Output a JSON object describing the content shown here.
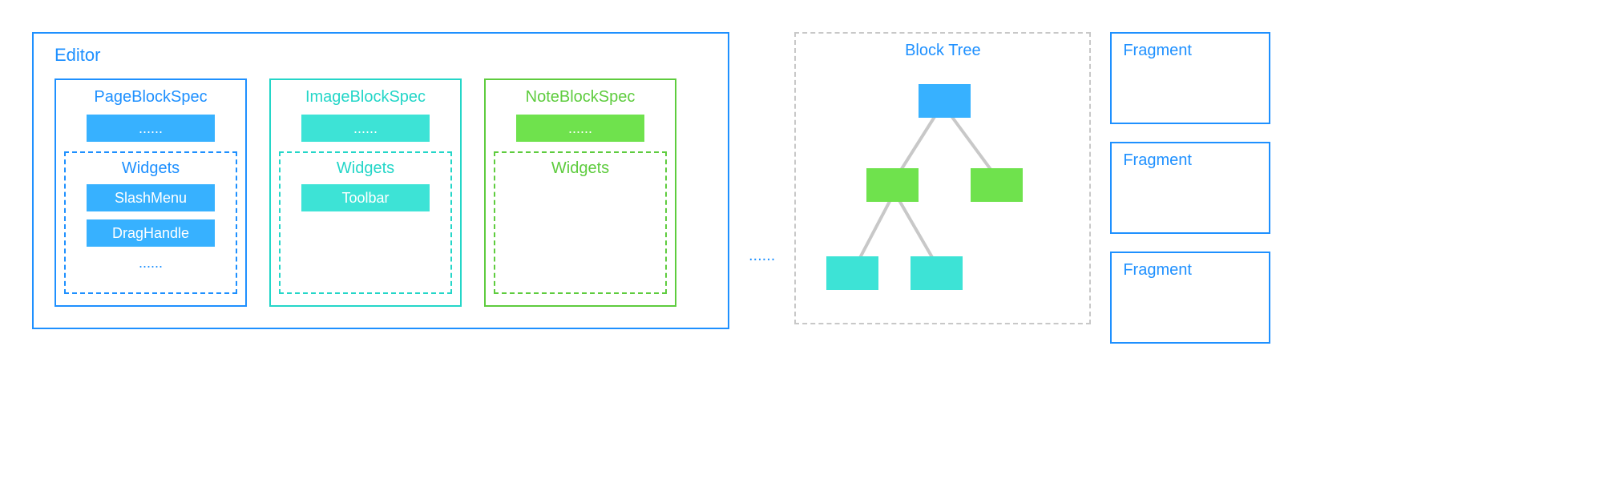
{
  "editor": {
    "title": "Editor",
    "specs": [
      {
        "title": "PageBlockSpec",
        "pill": "......",
        "widgets_title": "Widgets",
        "items": [
          "SlashMenu",
          "DragHandle"
        ],
        "ellipsis": "......"
      },
      {
        "title": "ImageBlockSpec",
        "pill": "......",
        "widgets_title": "Widgets",
        "items": [
          "Toolbar"
        ],
        "ellipsis": ""
      },
      {
        "title": "NoteBlockSpec",
        "pill": "......",
        "widgets_title": "Widgets",
        "items": [],
        "ellipsis": ""
      }
    ]
  },
  "gap": "......",
  "tree": {
    "title": "Block Tree"
  },
  "fragments": [
    "Fragment",
    "Fragment",
    "Fragment"
  ],
  "colors": {
    "blue": "#1E90FF",
    "blue_fill": "#37B1FF",
    "teal": "#24D6C8",
    "teal_fill": "#3DE3D6",
    "green": "#5ECC3E",
    "green_fill": "#6FE24D",
    "gray": "#C8C8C8"
  }
}
